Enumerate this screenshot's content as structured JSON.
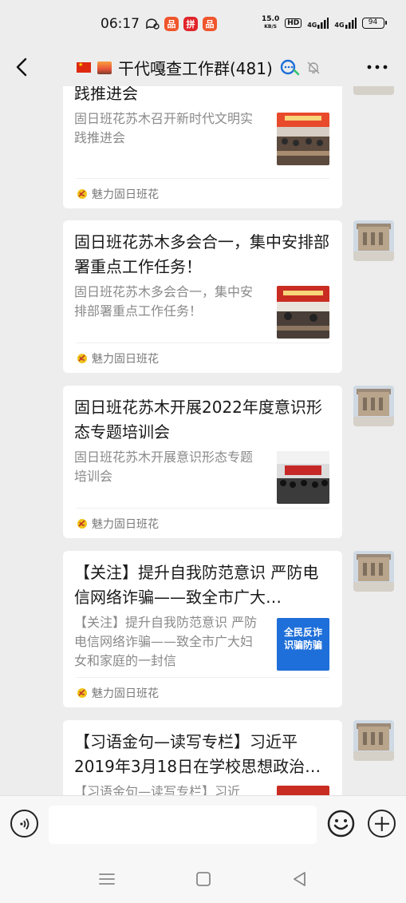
{
  "status_bar": {
    "time": "06:17",
    "speed_value": "15.0",
    "speed_unit": "KB/S",
    "hd": "HD",
    "net1": "4G",
    "net2": "4G",
    "battery": "94"
  },
  "header": {
    "title": "干代嘎查工作群(481)"
  },
  "messages": [
    {
      "title": "践推进会",
      "desc": "固日班花苏木召开新时代文明实践推进会",
      "source": "魅力固日班花"
    },
    {
      "title": "固日班花苏木多会合一，集中安排部署重点工作任务！",
      "desc": "固日班花苏木多会合一，集中安排部署重点工作任务！",
      "source": "魅力固日班花"
    },
    {
      "title": "固日班花苏木开展2022年度意识形态专题培训会",
      "desc": "固日班花苏木开展意识形态专题培训会",
      "source": "魅力固日班花"
    },
    {
      "title": "【关注】提升自我防范意识 严防电信网络诈骗——致全市广大…",
      "desc": "【关注】提升自我防范意识 严防电信网络诈骗——致全市广大妇女和家庭的一封信",
      "source": "魅力固日班花",
      "thumb_text": "全民反诈 识骗防骗"
    },
    {
      "title": "【习语金句—读写专栏】习近平2019年3月18日在学校思想政治…",
      "desc": "【习语金句—读写专栏】习近"
    }
  ],
  "input": {
    "placeholder": ""
  },
  "colors": {
    "background": "#ededed",
    "card": "#ffffff",
    "desc_text": "#8a8a8a",
    "accent_blue": "#1e6fd9"
  }
}
